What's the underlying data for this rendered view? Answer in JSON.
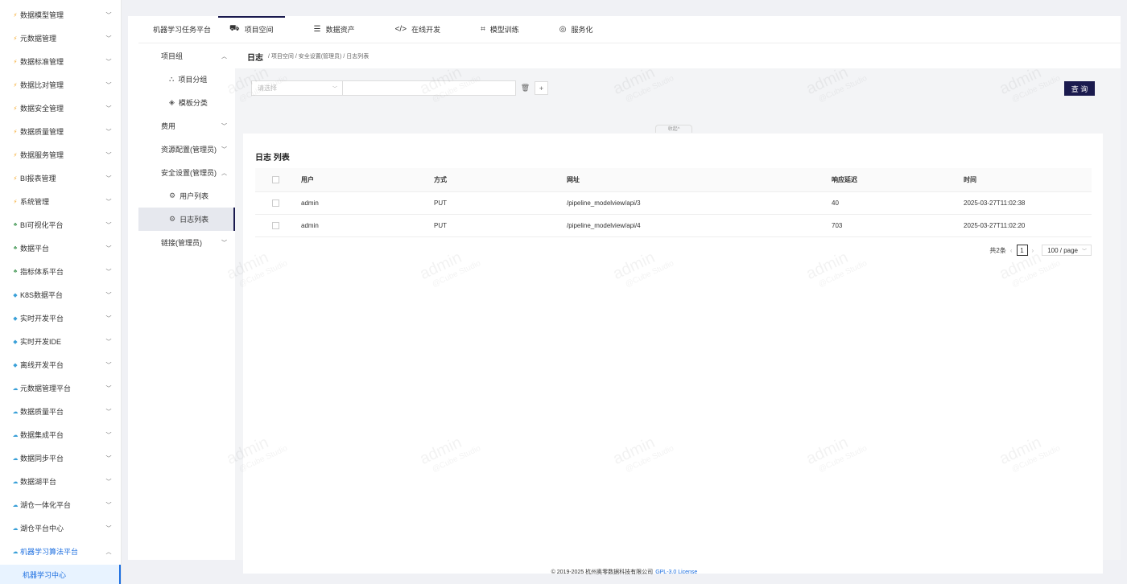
{
  "sidebar": {
    "items": [
      {
        "label": "数据模型管理",
        "icon": "bolt-icon"
      },
      {
        "label": "元数据管理",
        "icon": "bolt-icon"
      },
      {
        "label": "数据标准管理",
        "icon": "bolt-icon"
      },
      {
        "label": "数据比对管理",
        "icon": "bolt-icon"
      },
      {
        "label": "数据安全管理",
        "icon": "bolt-icon"
      },
      {
        "label": "数据质量管理",
        "icon": "bolt-icon"
      },
      {
        "label": "数据服务管理",
        "icon": "bolt-icon"
      },
      {
        "label": "BI报表管理",
        "icon": "bolt-icon"
      },
      {
        "label": "系统管理",
        "icon": "bolt-icon"
      },
      {
        "label": "BI可视化平台",
        "icon": "tree-icon"
      },
      {
        "label": "数据平台",
        "icon": "tree-icon"
      },
      {
        "label": "指标体系平台",
        "icon": "tree-icon"
      },
      {
        "label": "K8S数据平台",
        "icon": "diamond-icon"
      },
      {
        "label": "实时开发平台",
        "icon": "diamond-icon"
      },
      {
        "label": "实时开发IDE",
        "icon": "diamond-icon"
      },
      {
        "label": "离线开发平台",
        "icon": "diamond-icon"
      },
      {
        "label": "元数据管理平台",
        "icon": "cloud-icon"
      },
      {
        "label": "数据质量平台",
        "icon": "cloud-icon"
      },
      {
        "label": "数据集成平台",
        "icon": "cloud-icon"
      },
      {
        "label": "数据同步平台",
        "icon": "cloud-icon"
      },
      {
        "label": "数据湖平台",
        "icon": "cloud-icon"
      },
      {
        "label": "湖仓一体化平台",
        "icon": "cloud-icon"
      },
      {
        "label": "湖仓平台中心",
        "icon": "cloud-icon"
      },
      {
        "label": "机器学习算法平台",
        "icon": "cloud-icon"
      }
    ],
    "active_sub": "机器学习中心"
  },
  "topnav": {
    "brand": "机器学习任务平台",
    "tabs": [
      {
        "label": "项目空间",
        "icon": "car-icon",
        "active": true
      },
      {
        "label": "数据资产",
        "icon": "database-icon"
      },
      {
        "label": "在线开发",
        "icon": "code-icon"
      },
      {
        "label": "模型训练",
        "icon": "model-icon"
      },
      {
        "label": "服务化",
        "icon": "service-icon"
      }
    ]
  },
  "submenu": {
    "project_group": "项目组",
    "project_sub": "项目分组",
    "template": "模板分类",
    "cost": "费用",
    "resource": "资源配置(管理员)",
    "security": "安全设置(管理员)",
    "user_list": "用户列表",
    "log_list": "日志列表",
    "link": "链接(管理员)"
  },
  "header": {
    "title": "日志",
    "breadcrumb": "/ 项目空间 / 安全设置(管理员) / 日志列表"
  },
  "filter": {
    "select_placeholder": "请选择",
    "query_label": "查 询",
    "collapse_label": "收起"
  },
  "table": {
    "title": "日志 列表",
    "columns": [
      "用户",
      "方式",
      "网址",
      "响应延迟",
      "时间"
    ],
    "rows": [
      [
        "admin",
        "PUT",
        "/pipeline_modelview/api/3",
        "40",
        "2025-03-27T11:02:38"
      ],
      [
        "admin",
        "PUT",
        "/pipeline_modelview/api/4",
        "703",
        "2025-03-27T11:02:20"
      ]
    ]
  },
  "pager": {
    "total": "共2条",
    "page": "1",
    "page_size": "100 / page"
  },
  "footer": {
    "copyright": "© 2019-2025 杭州奥零数据科技有限公司",
    "license": "GPL-3.0 License"
  },
  "watermark": {
    "line1": "admin",
    "line2": "@Cube Studio"
  },
  "colors": {
    "accent": "#1a1a4e",
    "link": "#1d6fe0"
  }
}
